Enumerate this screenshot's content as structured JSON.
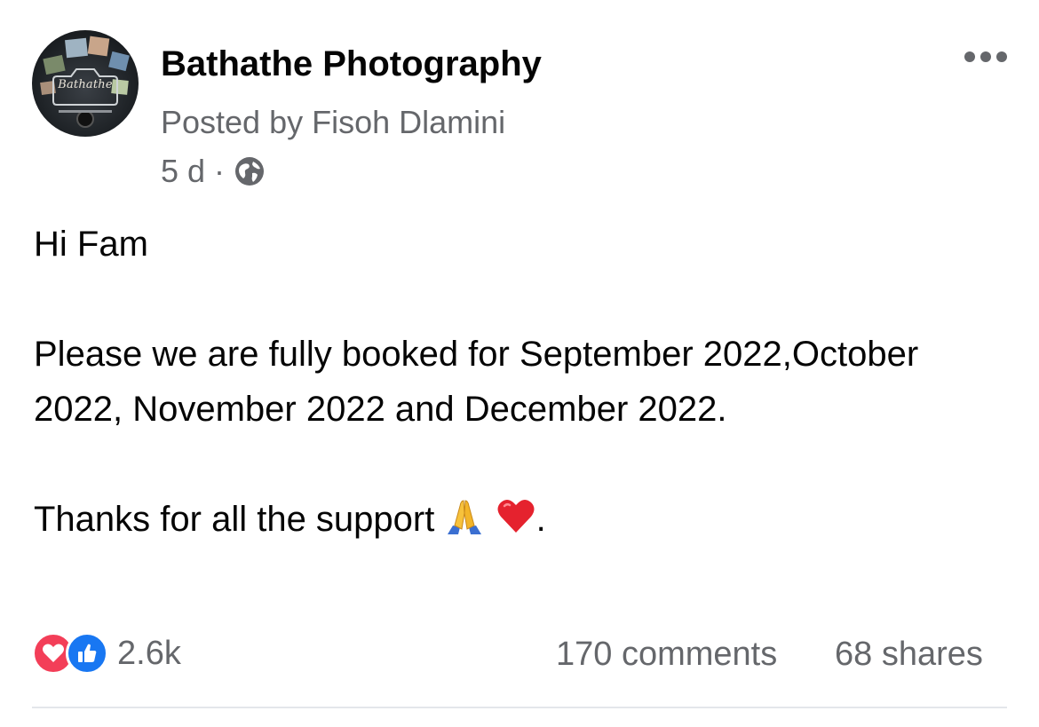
{
  "post": {
    "page_name": "Bathathe Photography",
    "posted_by": "Posted by Fisoh Dlamini",
    "time_ago": "5 d",
    "separator": "·",
    "privacy_icon": "globe-icon",
    "avatar_logo_text": "Bathathe",
    "more_icon": "more-horizontal-icon",
    "body": {
      "greeting": "Hi Fam",
      "message": "Please we are fully booked for September 2022,October 2022, November 2022 and December 2022.",
      "thanks": "Thanks for all the support",
      "thanks_emojis": [
        "folded-hands-icon",
        "red-heart-icon"
      ],
      "thanks_end": "."
    },
    "footer": {
      "reaction_icons": [
        "love-reaction-icon",
        "like-reaction-icon"
      ],
      "reaction_count": "2.6k",
      "comments": "170 comments",
      "shares": "68 shares"
    }
  },
  "colors": {
    "primary_text": "#050505",
    "secondary_text": "#65676b",
    "like_blue": "#1877f2",
    "love_red": "#f33e58",
    "divider": "#e4e6eb"
  }
}
